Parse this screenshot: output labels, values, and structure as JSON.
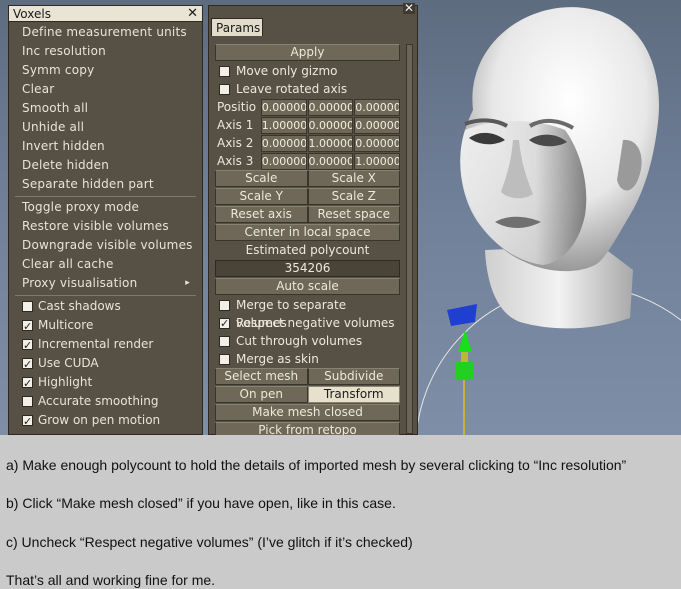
{
  "voxels_menu": {
    "title": "Voxels",
    "close_glyph": "✕",
    "items": [
      "Define measurement units",
      "Inc resolution",
      "Symm copy",
      "Clear",
      "Smooth all",
      "Unhide all",
      "Invert hidden",
      "Delete hidden",
      "Separate hidden part"
    ],
    "items2": [
      "Toggle proxy mode",
      "Restore visible volumes",
      "Downgrade visible volumes",
      "Clear all cache",
      "Proxy visualisation"
    ],
    "submenu_arrow": "▸",
    "checks": [
      {
        "label": "Cast shadows",
        "checked": false
      },
      {
        "label": "Multicore",
        "checked": true
      },
      {
        "label": "Incremental render",
        "checked": true
      },
      {
        "label": "Use CUDA",
        "checked": true
      },
      {
        "label": "Highlight",
        "checked": true
      },
      {
        "label": "Accurate smoothing",
        "checked": false
      },
      {
        "label": "Grow on pen motion",
        "checked": true
      }
    ]
  },
  "params": {
    "tab": "Params",
    "close_glyph": "✕",
    "apply": "Apply",
    "move_only_gizmo": {
      "label": "Move only gizmo",
      "checked": false
    },
    "leave_rotated_axis": {
      "label": "Leave rotated axis",
      "checked": false
    },
    "vectors": [
      {
        "label": "Positio",
        "values": [
          "0.00000",
          "0.00000",
          "0.00000"
        ]
      },
      {
        "label": "Axis 1",
        "values": [
          "1.00000",
          "0.00000",
          "0.00000"
        ]
      },
      {
        "label": "Axis 2",
        "values": [
          "0.00000",
          "1.00000",
          "0.00000"
        ]
      },
      {
        "label": "Axis 3",
        "values": [
          "0.00000",
          "0.00000",
          "1.00000"
        ]
      }
    ],
    "scale": "Scale",
    "scale_x": "Scale X",
    "scale_y": "Scale Y",
    "scale_z": "Scale Z",
    "reset_axis": "Reset axis",
    "reset_space": "Reset space",
    "center_local": "Center in local space",
    "estimated_polycount": "Estimated polycount",
    "polycount_value": "354206",
    "auto_scale": "Auto scale",
    "merge_separate": {
      "label": "Merge to separate volumes",
      "checked": false
    },
    "respect_negative": {
      "label": "Respect negative volumes",
      "checked": true
    },
    "cut_through": {
      "label": "Cut through volumes",
      "checked": false
    },
    "merge_skin": {
      "label": "Merge as skin",
      "checked": false
    },
    "select_mesh": "Select mesh",
    "subdivide": "Subdivide",
    "on_pen": "On pen",
    "transform": "Transform",
    "make_mesh_closed": "Make mesh closed",
    "pick_from_retopo": "Pick from retopo"
  },
  "caption": {
    "a": "a) Make enough polycount to hold the details of imported mesh by several clicking to “Inc resolution”",
    "b": "b) Click “Make mesh closed” if you have open, like in this case.",
    "c": "c) Uncheck “Respect negative volumes” (I’ve glitch if it’s checked)",
    "d": "That’s all and working fine for me."
  }
}
